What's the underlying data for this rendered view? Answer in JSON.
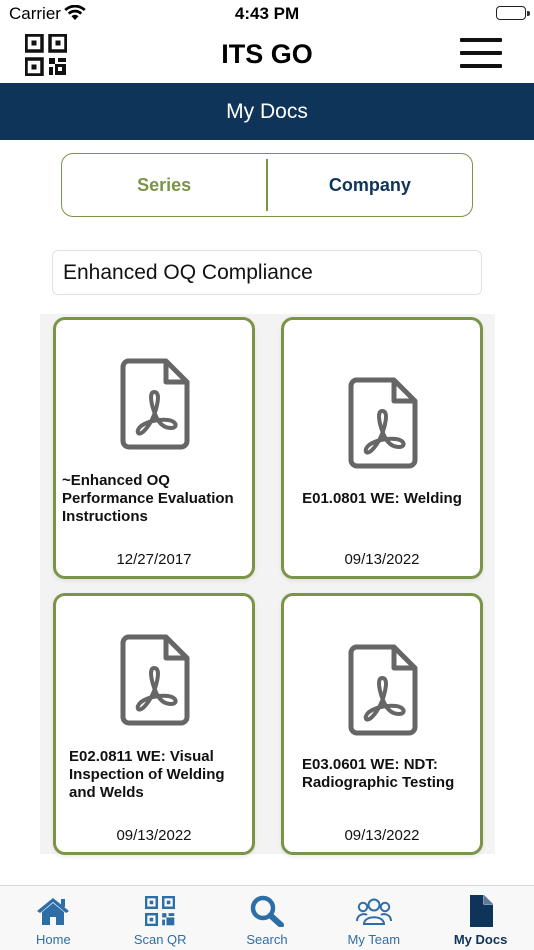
{
  "status_bar": {
    "carrier": "Carrier",
    "time": "4:43 PM"
  },
  "header": {
    "title": "ITS GO",
    "qr_icon": "qr-code-icon",
    "menu_icon": "hamburger-menu-icon"
  },
  "page": {
    "title": "My Docs"
  },
  "segments": {
    "series": "Series",
    "company": "Company",
    "selected": "series"
  },
  "series_field": {
    "value": "Enhanced OQ Compliance"
  },
  "documents": [
    {
      "title": "~Enhanced OQ Performance Evaluation Instructions",
      "date": "12/27/2017",
      "icon": "pdf-file-icon"
    },
    {
      "title": "E01.0801 WE: Welding",
      "date": "09/13/2022",
      "icon": "pdf-file-icon"
    },
    {
      "title": "E02.0811 WE: Visual Inspection of Welding and Welds",
      "date": "09/13/2022",
      "icon": "pdf-file-icon"
    },
    {
      "title": "E03.0601 WE: NDT: Radiographic Testing",
      "date": "09/13/2022",
      "icon": "pdf-file-icon"
    }
  ],
  "tabs": [
    {
      "label": "Home",
      "icon": "home-icon"
    },
    {
      "label": "Scan QR",
      "icon": "qr-code-icon"
    },
    {
      "label": "Search",
      "icon": "search-icon"
    },
    {
      "label": "My Team",
      "icon": "team-icon"
    },
    {
      "label": "My Docs",
      "icon": "document-icon",
      "active": true
    }
  ],
  "colors": {
    "navy": "#0f3459",
    "olive": "#7a9448",
    "tab_blue": "#2e6ea6"
  }
}
